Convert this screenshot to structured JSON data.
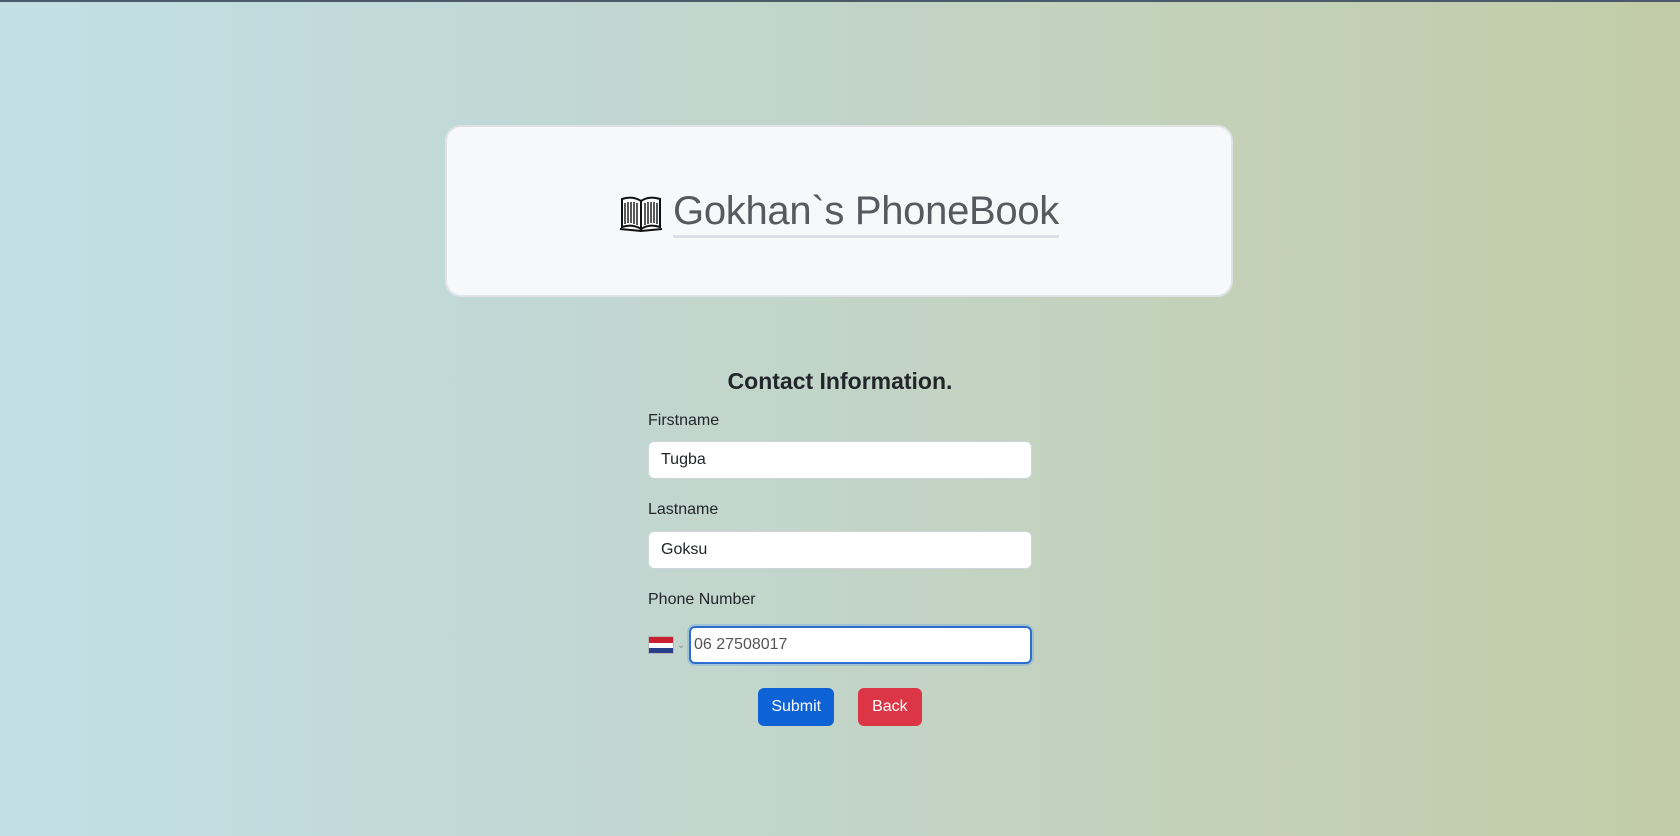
{
  "header": {
    "icon": "book-icon",
    "title": "Gokhan`s PhoneBook"
  },
  "form": {
    "heading": "Contact Information.",
    "firstname": {
      "label": "Firstname",
      "value": "Tugba"
    },
    "lastname": {
      "label": "Lastname",
      "value": "Goksu"
    },
    "phone": {
      "label": "Phone Number",
      "country_flag": "netherlands-flag-icon",
      "value": "06 27508017"
    },
    "submit_label": "Submit",
    "back_label": "Back"
  },
  "colors": {
    "primary": "#0d62d6",
    "danger": "#dc3545",
    "focus_border": "#2d6dcc"
  }
}
